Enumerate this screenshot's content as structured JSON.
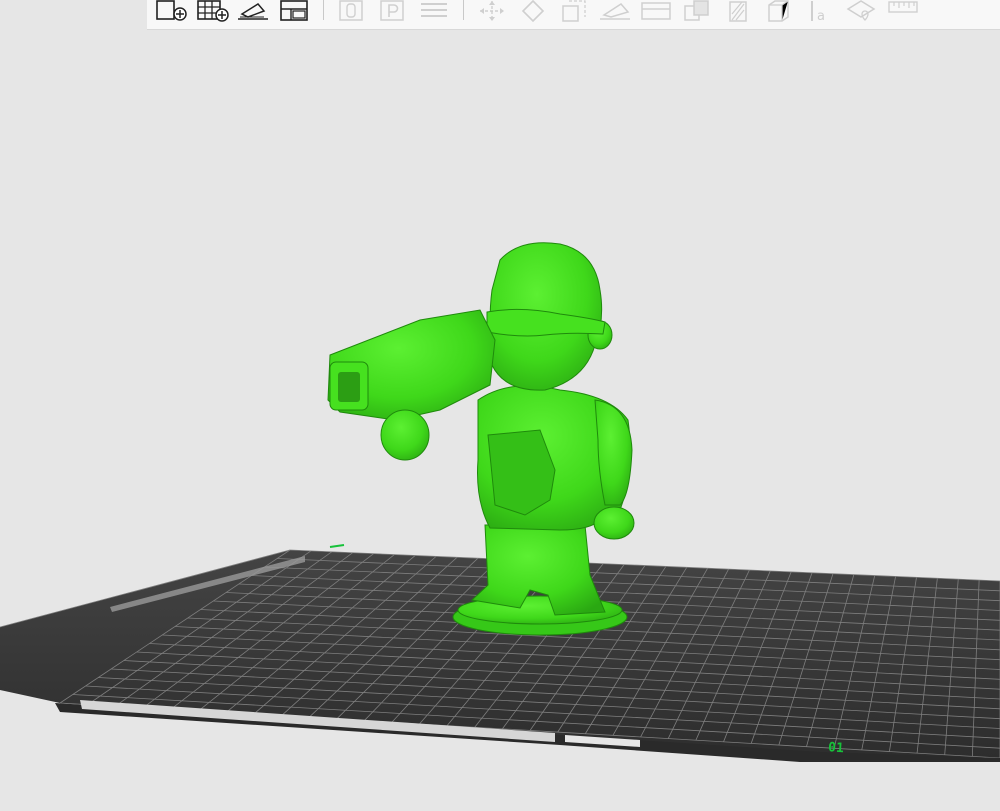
{
  "toolbar": {
    "buttons": [
      {
        "name": "add-object-button",
        "icon": "add-object-icon",
        "enabled": true
      },
      {
        "name": "add-instances-button",
        "icon": "add-grid-icon",
        "enabled": true
      },
      {
        "name": "arrange-button",
        "icon": "arrange-icon",
        "enabled": true
      },
      {
        "name": "split-layout-button",
        "icon": "layout-icon",
        "enabled": true
      },
      {
        "name": "orient-button",
        "icon": "orient-icon",
        "enabled": false
      },
      {
        "name": "plate-button",
        "icon": "plate-icon",
        "enabled": false
      },
      {
        "name": "layers-button",
        "icon": "layers-icon",
        "enabled": false
      },
      {
        "name": "move-button",
        "icon": "move-icon",
        "enabled": false
      },
      {
        "name": "rotate-button",
        "icon": "rotate-icon",
        "enabled": false
      },
      {
        "name": "scale-button",
        "icon": "scale-icon",
        "enabled": false
      },
      {
        "name": "lay-on-face-button",
        "icon": "lay-on-face-icon",
        "enabled": false
      },
      {
        "name": "cut-button",
        "icon": "cut-icon",
        "enabled": false
      },
      {
        "name": "boolean-button",
        "icon": "boolean-icon",
        "enabled": false
      },
      {
        "name": "support-paint-button",
        "icon": "support-paint-icon",
        "enabled": false
      },
      {
        "name": "seam-paint-button",
        "icon": "seam-paint-icon",
        "enabled": false
      },
      {
        "name": "text-button",
        "icon": "text-icon",
        "enabled": false
      },
      {
        "name": "color-paint-button",
        "icon": "color-paint-icon",
        "enabled": false
      },
      {
        "name": "measure-button",
        "icon": "measure-icon",
        "enabled": false
      }
    ]
  },
  "viewport": {
    "model": {
      "name": "figure-model",
      "color": "#3fe21a"
    },
    "plate": {
      "color": "#3a3a3a",
      "grid_color": "#8a8a8a",
      "label": "01",
      "label_color": "#17c23a"
    }
  }
}
